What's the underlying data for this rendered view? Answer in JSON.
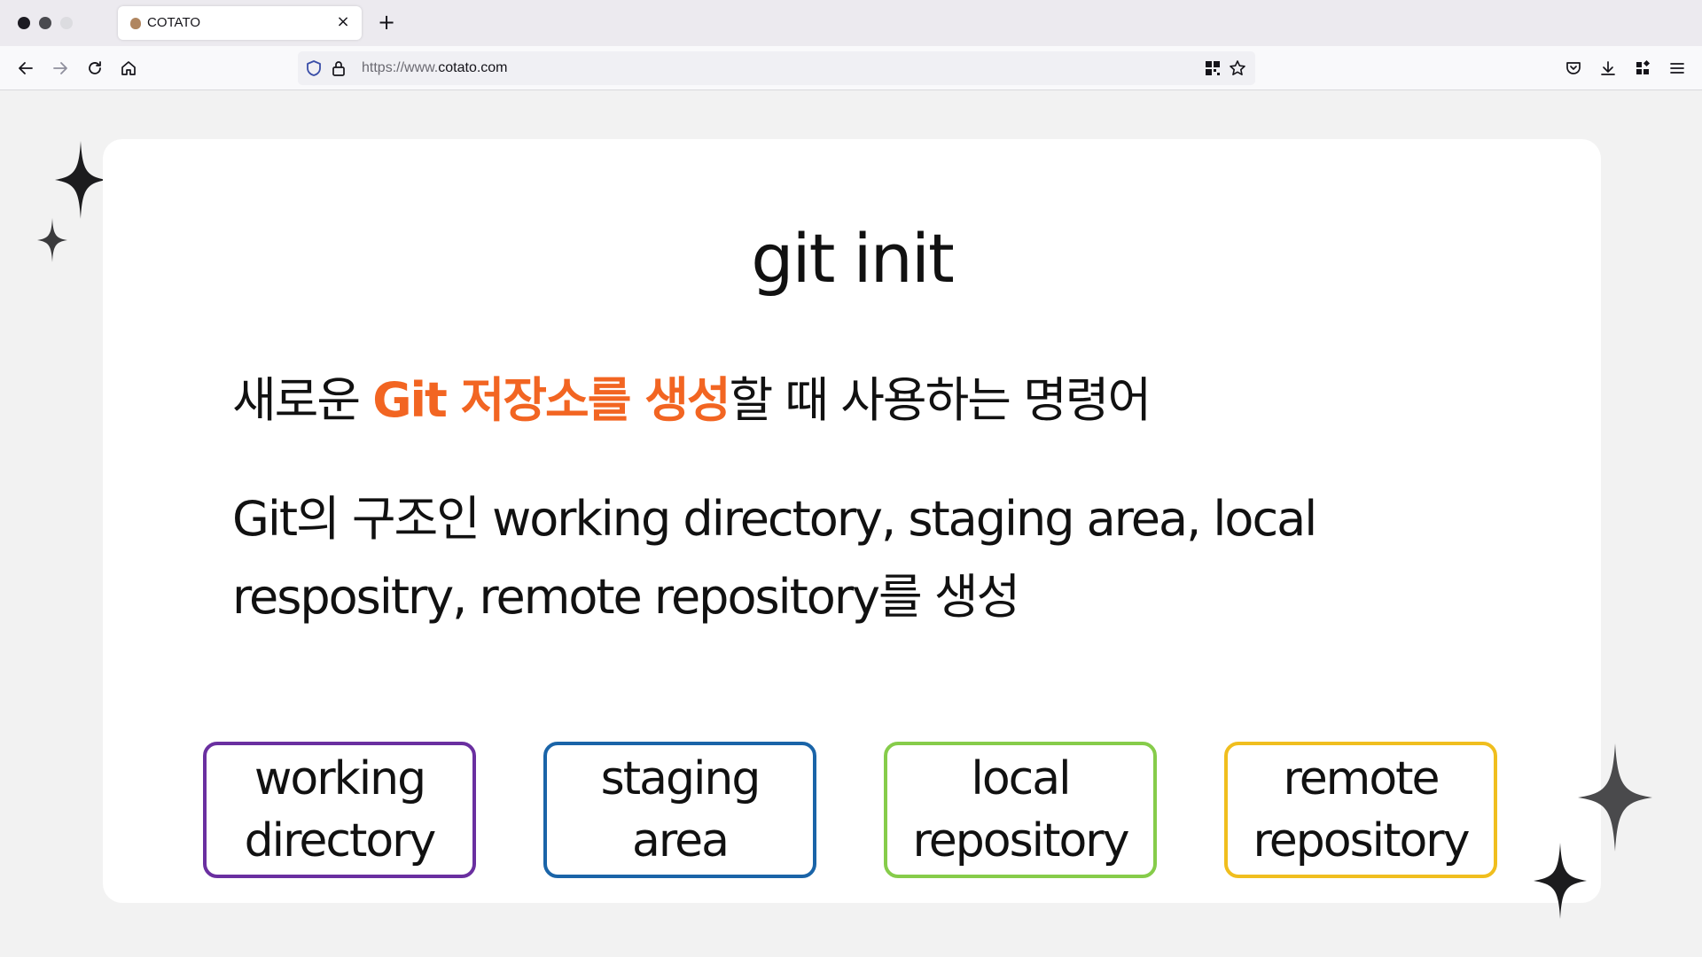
{
  "browser": {
    "tab_title": "COTATO",
    "tab_close_glyph": "×",
    "new_tab_glyph": "+",
    "url_protocol": "https://www.",
    "url_domain": "cotato.com",
    "traffic_colors": [
      "#1c1b22",
      "#4a4a4f",
      "#dcdce0"
    ]
  },
  "slide": {
    "title": "git init",
    "line1_before": "새로운 ",
    "line1_highlight": "Git 저장소를 생성",
    "line1_after": "할 때 사용하는 명령어",
    "line2": "Git의 구조인 working directory, staging area, local respositry, remote repository를 생성",
    "highlight_color": "#f26522",
    "boxes": [
      {
        "line1": "working",
        "line2": "directory",
        "color": "#6a2fa0"
      },
      {
        "line1": "staging",
        "line2": "area",
        "color": "#1a64a8"
      },
      {
        "line1": "local",
        "line2": "repository",
        "color": "#86cc4a"
      },
      {
        "line1": "remote",
        "line2": "repository",
        "color": "#f0be1e"
      }
    ]
  },
  "icons": {
    "back": "arrow-left-icon",
    "forward": "arrow-right-icon",
    "reload": "reload-icon",
    "home": "home-icon",
    "shield": "shield-icon",
    "lock": "lock-icon",
    "qr": "qr-code-icon",
    "star": "star-icon",
    "pocket": "pocket-icon",
    "download": "download-icon",
    "extensions": "extensions-icon",
    "menu": "hamburger-menu-icon"
  }
}
